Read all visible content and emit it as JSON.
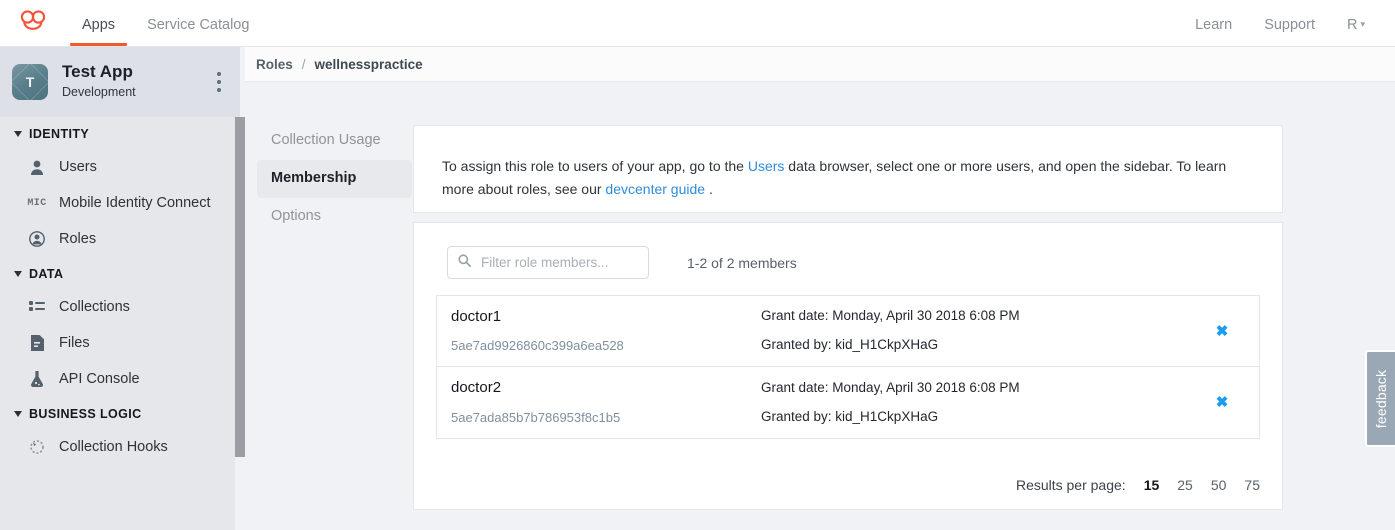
{
  "topbar": {
    "logo_icon": "kinvey-logo-icon",
    "nav": [
      {
        "label": "Apps",
        "active": true
      },
      {
        "label": "Service Catalog",
        "active": false
      }
    ],
    "right": [
      {
        "label": "Learn"
      },
      {
        "label": "Support"
      },
      {
        "label": "R"
      }
    ],
    "account_chevron": "⌄"
  },
  "app_header": {
    "avatar_initial": "T",
    "title": "Test App",
    "subtitle": "Development",
    "menu_icon": "kebab-menu-icon"
  },
  "sidebar": {
    "groups": [
      {
        "label": "IDENTITY",
        "items": [
          {
            "label": "Users",
            "icon": "user-icon"
          },
          {
            "label": "Mobile Identity Connect",
            "icon": "mic-icon"
          },
          {
            "label": "Roles",
            "icon": "role-avatar-icon"
          }
        ]
      },
      {
        "label": "DATA",
        "items": [
          {
            "label": "Collections",
            "icon": "list-icon"
          },
          {
            "label": "Files",
            "icon": "file-icon"
          },
          {
            "label": "API Console",
            "icon": "flask-icon"
          }
        ]
      },
      {
        "label": "BUSINESS LOGIC",
        "items": [
          {
            "label": "Collection Hooks",
            "icon": "hook-icon"
          }
        ]
      }
    ]
  },
  "breadcrumb": {
    "root": "Roles",
    "separator": "/",
    "current": "wellnesspractice"
  },
  "tabs": [
    {
      "label": "Collection Usage",
      "active": false
    },
    {
      "label": "Membership",
      "active": true
    },
    {
      "label": "Options",
      "active": false
    }
  ],
  "banner": {
    "part1": "To assign this role to users of your app, go to the",
    "link1": "Users",
    "part2": "data browser, select one or more users, and open the sidebar. To learn more about roles, see our",
    "link2": "devcenter guide",
    "part3": "."
  },
  "members_panel": {
    "search": {
      "placeholder": "Filter role members...",
      "value": "",
      "icon": "search-icon"
    },
    "count_label": "1-2 of 2 members",
    "rows": [
      {
        "username": "doctor1",
        "user_id": "5ae7ad9926860c399a6ea528",
        "grant_date": "Grant date: Monday, April 30 2018 6:08 PM",
        "granted_by": "Granted by: kid_H1CkpXHaG",
        "remove_icon": "✖"
      },
      {
        "username": "doctor2",
        "user_id": "5ae7ada85b7b786953f8c1b5",
        "grant_date": "Grant date: Monday, April 30 2018 6:08 PM",
        "granted_by": "Granted by: kid_H1CkpXHaG",
        "remove_icon": "✖"
      }
    ],
    "results_per_page": {
      "label": "Results per page:",
      "options": [
        {
          "value": "15",
          "active": true
        },
        {
          "value": "25",
          "active": false
        },
        {
          "value": "50",
          "active": false
        },
        {
          "value": "75",
          "active": false
        }
      ]
    }
  },
  "feedback_tab": {
    "label": "feedback"
  },
  "colors": {
    "accent_orange": "#f05a28",
    "link_blue": "#2f8bdb",
    "remove_blue": "#1b9cf0",
    "page_bg": "#f1f2f6",
    "sidebar_bg": "#e5e7eb",
    "apphead_bg": "#dde0e7",
    "feedback_bg": "#9aa8b5"
  }
}
